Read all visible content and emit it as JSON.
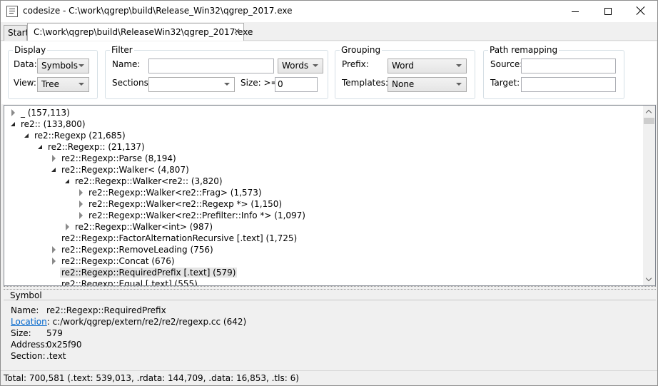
{
  "window": {
    "title": "codesize - C:\\work\\qgrep\\build\\Release_Win32\\qgrep_2017.exe"
  },
  "tabs": [
    {
      "label": "Start"
    },
    {
      "label": "C:\\work\\qgrep\\build\\ReleaseWin32\\qgrep_2017.exe",
      "close": "✕"
    }
  ],
  "display": {
    "legend": "Display",
    "data_label": "Data:",
    "data_value": "Symbols",
    "view_label": "View:",
    "view_value": "Tree"
  },
  "filter": {
    "legend": "Filter",
    "name_label": "Name:",
    "name_value": "",
    "mode_value": "Words",
    "sections_label": "Sections:",
    "sections_value": "",
    "size_label": "Size: >=",
    "size_value": "0"
  },
  "grouping": {
    "legend": "Grouping",
    "prefix_label": "Prefix:",
    "prefix_value": "Word",
    "templates_label": "Templates:",
    "templates_value": "None"
  },
  "path_remapping": {
    "legend": "Path remapping",
    "source_label": "Source:",
    "source_value": "",
    "target_label": "Target:",
    "target_value": ""
  },
  "tree": [
    {
      "text": "_ (157,113)",
      "depth": 0,
      "expander": "collapsed"
    },
    {
      "text": "re2:: (133,800)",
      "depth": 0,
      "expander": "open"
    },
    {
      "text": "re2::Regexp (21,685)",
      "depth": 1,
      "expander": "open"
    },
    {
      "text": "re2::Regexp:: (21,137)",
      "depth": 2,
      "expander": "open"
    },
    {
      "text": "re2::Regexp::Parse (8,194)",
      "depth": 3,
      "expander": "collapsed"
    },
    {
      "text": "re2::Regexp::Walker< (4,807)",
      "depth": 3,
      "expander": "open"
    },
    {
      "text": "re2::Regexp::Walker<re2:: (3,820)",
      "depth": 4,
      "expander": "open"
    },
    {
      "text": "re2::Regexp::Walker<re2::Frag> (1,573)",
      "depth": 5,
      "expander": "collapsed"
    },
    {
      "text": "re2::Regexp::Walker<re2::Regexp *> (1,150)",
      "depth": 5,
      "expander": "collapsed"
    },
    {
      "text": "re2::Regexp::Walker<re2::Prefilter::Info *> (1,097)",
      "depth": 5,
      "expander": "collapsed"
    },
    {
      "text": "re2::Regexp::Walker<int> (987)",
      "depth": 4,
      "expander": "collapsed"
    },
    {
      "text": "re2::Regexp::FactorAlternationRecursive [.text] (1,725)",
      "depth": 3,
      "expander": "none"
    },
    {
      "text": "re2::Regexp::RemoveLeading (756)",
      "depth": 3,
      "expander": "collapsed"
    },
    {
      "text": "re2::Regexp::Concat (676)",
      "depth": 3,
      "expander": "collapsed"
    },
    {
      "text": "re2::Regexp::RequiredPrefix [.text] (579)",
      "depth": 3,
      "expander": "none",
      "selected": true
    },
    {
      "text": "re2::Regexp::Equal [.text] (555)",
      "depth": 3,
      "expander": "none"
    }
  ],
  "symbol": {
    "header": "Symbol",
    "name_label": "Name:",
    "name_value": "re2::Regexp::RequiredPrefix",
    "location_label": "Location",
    "location_value": ": c:/work/qgrep/extern/re2/re2/regexp.cc (642)",
    "size_label": "Size:",
    "size_value": "579",
    "address_label": "Address:",
    "address_value": "0x25f90",
    "section_label": "Section:",
    "section_value": ".text"
  },
  "status": {
    "text": "Total: 700,581 (.text: 539,013, .rdata: 144,709, .data: 16,853, .tls: 6)"
  },
  "icons": [
    "app-icon",
    "minimize-icon",
    "maximize-icon",
    "close-icon",
    "tab-close-icon",
    "dropdown-arrow-icon",
    "expander-icon",
    "scroll-up-icon",
    "scroll-down-icon"
  ]
}
